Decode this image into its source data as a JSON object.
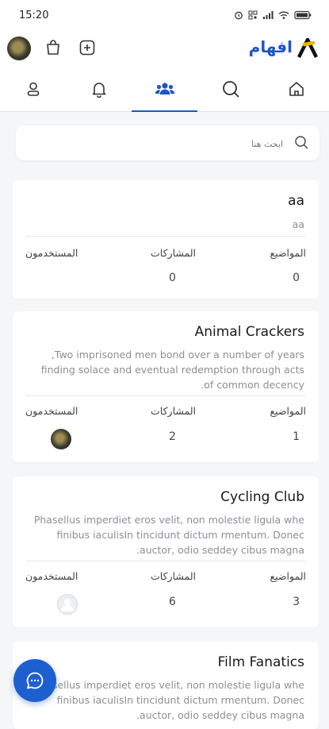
{
  "status_bar": {
    "time": "15:20"
  },
  "header": {
    "brand_name": "افهام"
  },
  "search": {
    "placeholder": "ابحث هنا"
  },
  "labels": {
    "topics": "المواضيع",
    "posts": "المشاركات",
    "users": "المستخدمون"
  },
  "communities": [
    {
      "name": "aa",
      "description": "aa",
      "topics": "0",
      "posts": "0"
    },
    {
      "name": "Animal Crackers",
      "description_lines": [
        "Two imprisoned men bond over a number of years,",
        "finding solace and eventual redemption through acts",
        "of common decency."
      ],
      "topics": "1",
      "posts": "2"
    },
    {
      "name": "Cycling Club",
      "description_lines": [
        "Phasellus imperdiet eros velit, non molestie ligula whe",
        "finibus iaculisIn tincidunt dictum rmentum. Donec",
        "auctor, odio seddey cibus magna."
      ],
      "topics": "3",
      "posts": "6"
    },
    {
      "name": "Film Fanatics",
      "description_lines": [
        "Phasellus imperdiet eros velit, non molestie ligula whe",
        "finibus iaculisIn tincidunt dictum rmentum. Donec",
        "auctor, odio seddey cibus magna."
      ]
    }
  ],
  "colors": {
    "accent": "#1e56c8",
    "fab": "#1e5fd0",
    "background": "#f5f6f8"
  },
  "icons": [
    "signal-icon",
    "wifi-icon",
    "battery-icon",
    "shopping-bag-icon",
    "add-square-icon",
    "home-icon",
    "search-icon",
    "community-icon",
    "notification-bell-icon",
    "profile-icon",
    "chat-icon"
  ]
}
